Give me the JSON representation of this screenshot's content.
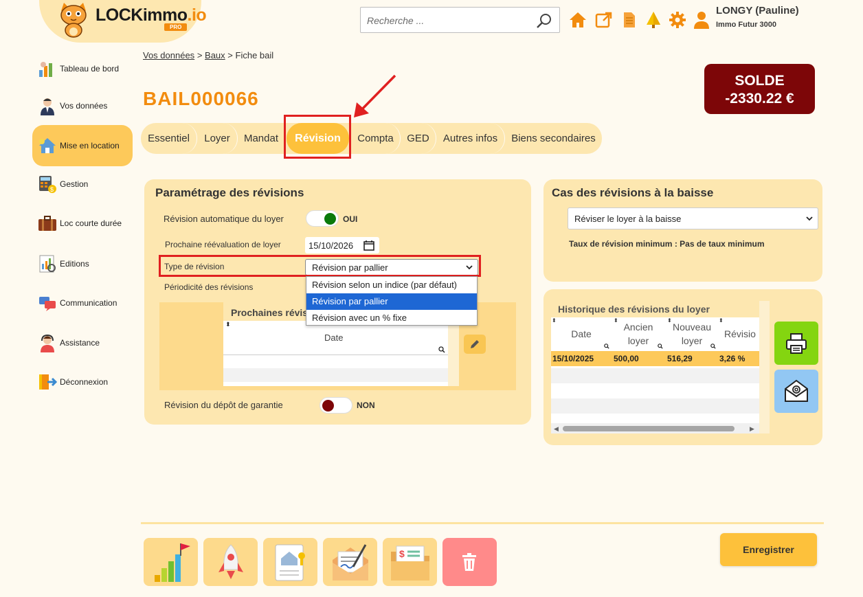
{
  "header": {
    "logo_text_main": "LOCKimmo",
    "logo_text_accent": ".io",
    "logo_badge": "PRO",
    "search_placeholder": "Recherche ...",
    "user_name": "LONGY (Pauline)",
    "user_company": "Immo Futur 3000",
    "icons": [
      "home-icon",
      "external-link-icon",
      "document-icon",
      "tree-icon",
      "gear-icon",
      "user-icon"
    ],
    "accent_color": "#f28c0f"
  },
  "sidebar": {
    "items": [
      {
        "label": "Tableau de bord",
        "icon": "dashboard-icon"
      },
      {
        "label": "Vos données",
        "icon": "person-icon"
      },
      {
        "label": "Mise en location",
        "icon": "house-icon",
        "active": true
      },
      {
        "label": "Gestion",
        "icon": "calculator-icon"
      },
      {
        "label": "Loc courte durée",
        "icon": "suitcase-icon"
      },
      {
        "label": "Editions",
        "icon": "report-icon"
      },
      {
        "label": "Communication",
        "icon": "chat-icon"
      },
      {
        "label": "Assistance",
        "icon": "headset-icon"
      },
      {
        "label": "Déconnexion",
        "icon": "logout-icon"
      }
    ]
  },
  "breadcrumb": {
    "link1": "Vos données",
    "sep1": ">",
    "link2": "Baux",
    "sep2": ">",
    "current": "Fiche bail"
  },
  "page_title": "BAIL000066",
  "solde": {
    "label": "SOLDE",
    "value": "-2330.22 €",
    "color": "#7d0608"
  },
  "tabs": [
    {
      "label": "Essentiel"
    },
    {
      "label": "Loyer"
    },
    {
      "label": "Mandat"
    },
    {
      "label": "Révision",
      "active": true
    },
    {
      "label": "Compta"
    },
    {
      "label": "GED"
    },
    {
      "label": "Autres infos"
    },
    {
      "label": "Biens secondaires"
    }
  ],
  "revision_panel": {
    "title": "Paramétrage des révisions",
    "auto_label": "Révision automatique du loyer",
    "auto_value": "OUI",
    "next_label": "Prochaine réévaluation de loyer",
    "next_date": "15/10/2026",
    "type_label": "Type de révision",
    "type_selected": "Révision par pallier",
    "type_options": [
      "Révision selon un indice (par défaut)",
      "Révision par pallier",
      "Révision avec un % fixe"
    ],
    "periodicity_label": "Périodicité des révisions",
    "upcoming_title": "Prochaines révisi",
    "upcoming_col": "Date",
    "deposit_label": "Révision du dépôt de garantie",
    "deposit_value": "NON"
  },
  "baisse_panel": {
    "title": "Cas des révisions à la baisse",
    "selected": "Réviser le loyer à la baisse",
    "taux": "Taux de révision minimum : Pas de taux minimum"
  },
  "history": {
    "title": "Historique des révisions du loyer",
    "columns": [
      "Date",
      "Ancien loyer",
      "Nouveau loyer",
      "Révisio"
    ],
    "rows": [
      {
        "date": "15/10/2025",
        "ancien": "500,00",
        "nouveau": "516,29",
        "revision": "3,26 %"
      }
    ]
  },
  "footer": {
    "save_label": "Enregistrer",
    "buttons": [
      "progress-icon",
      "rocket-icon",
      "house-doc-icon",
      "signed-letter-icon",
      "invoice-folder-icon",
      "trash-icon"
    ]
  }
}
